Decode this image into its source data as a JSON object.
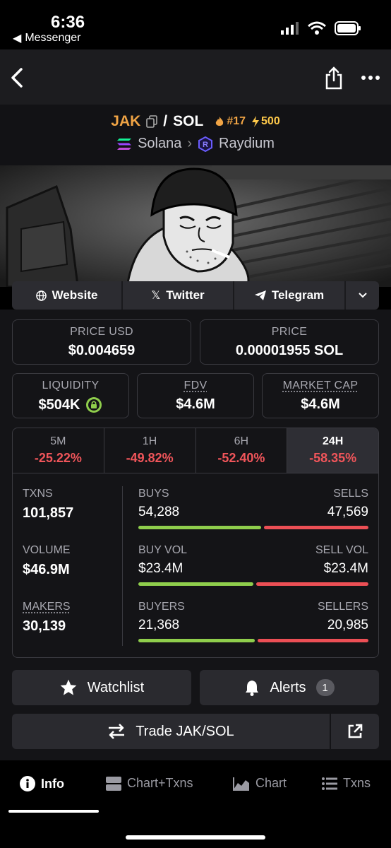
{
  "status": {
    "time": "6:36",
    "back_app": "Messenger"
  },
  "header": {
    "base": "JAK",
    "sep": "/",
    "quote": "SOL",
    "rank": "#17",
    "boost": "500",
    "chain": "Solana",
    "dex": "Raydium"
  },
  "links": {
    "website": "Website",
    "twitter": "Twitter",
    "telegram": "Telegram"
  },
  "stats": {
    "price_usd_label": "PRICE USD",
    "price_usd": "$0.004659",
    "price_label": "PRICE",
    "price": "0.00001955 SOL",
    "liquidity_label": "LIQUIDITY",
    "liquidity": "$504K",
    "fdv_label": "FDV",
    "fdv": "$4.6M",
    "mcap_label": "MARKET CAP",
    "mcap": "$4.6M"
  },
  "timeframes": [
    {
      "label": "5M",
      "change": "-25.22%"
    },
    {
      "label": "1H",
      "change": "-49.82%"
    },
    {
      "label": "6H",
      "change": "-52.40%"
    },
    {
      "label": "24H",
      "change": "-58.35%"
    }
  ],
  "activity": {
    "txns_label": "TXNS",
    "txns": "101,857",
    "volume_label": "VOLUME",
    "volume": "$46.9M",
    "makers_label": "MAKERS",
    "makers": "30,139",
    "buys_label": "BUYS",
    "buys": "54,288",
    "sells_label": "SELLS",
    "sells": "47,569",
    "buyvol_label": "BUY VOL",
    "buyvol": "$23.4M",
    "sellvol_label": "SELL VOL",
    "sellvol": "$23.4M",
    "buyers_label": "BUYERS",
    "buyers": "21,368",
    "sellers_label": "SELLERS",
    "sellers": "20,985",
    "buy_ratio": 0.533,
    "buyvol_ratio": 0.5,
    "buyer_ratio": 0.505
  },
  "actions": {
    "watchlist": "Watchlist",
    "alerts": "Alerts",
    "alerts_count": "1",
    "trade": "Trade JAK/SOL"
  },
  "tabs": {
    "info": "Info",
    "chart_txns": "Chart+Txns",
    "chart": "Chart",
    "txns": "Txns"
  },
  "colors": {
    "accent": "#f0a445",
    "negative": "#f0555a",
    "buy": "#8fce4c",
    "sell": "#ec4f55"
  }
}
